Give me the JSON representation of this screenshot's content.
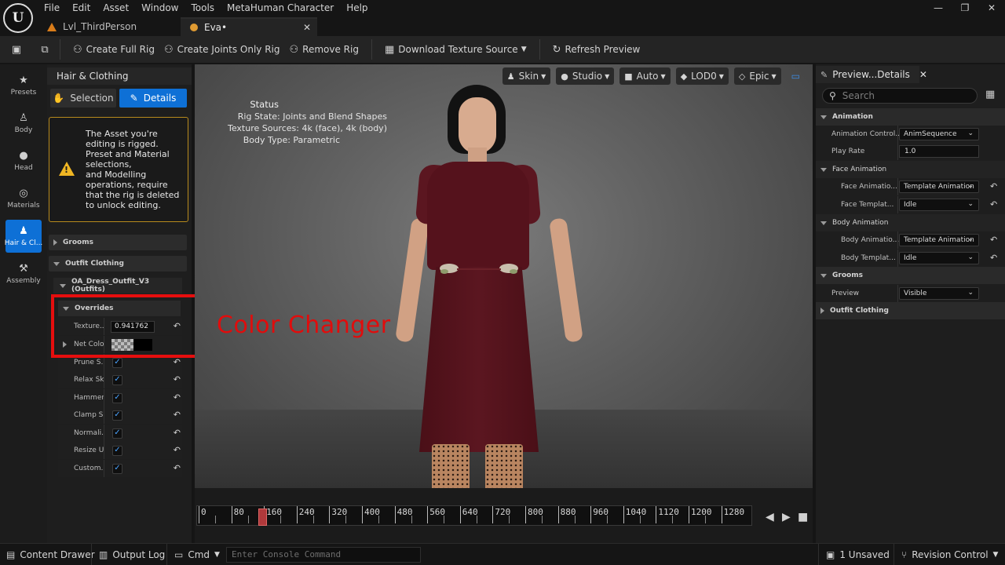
{
  "app": {
    "logo_text": "U"
  },
  "menu": [
    "File",
    "Edit",
    "Asset",
    "Window",
    "Tools",
    "MetaHuman Character",
    "Help"
  ],
  "window_controls": {
    "minimize": "—",
    "restore": "❐",
    "close": "✕"
  },
  "tabs": [
    {
      "label": "Lvl_ThirdPerson"
    },
    {
      "label": "Eva•",
      "close": "✕"
    }
  ],
  "toolbar": {
    "create_full_rig": "Create Full Rig",
    "create_joints_only_rig": "Create Joints Only Rig",
    "remove_rig": "Remove Rig",
    "download_texture_source": "Download Texture Source",
    "refresh_preview": "Refresh Preview"
  },
  "modes": [
    {
      "label": "Presets",
      "icon": "star-icon"
    },
    {
      "label": "Body",
      "icon": "body-icon"
    },
    {
      "label": "Head",
      "icon": "head-icon"
    },
    {
      "label": "Materials",
      "icon": "materials-icon"
    },
    {
      "label": "Hair & Cl...",
      "icon": "hair-clothing-icon",
      "active": true
    },
    {
      "label": "Assembly",
      "icon": "hammer-icon"
    }
  ],
  "left_panel": {
    "title": "Hair & Clothing",
    "selection_label": "Selection",
    "details_label": "Details",
    "warning_text": "The Asset you're\nediting is rigged.\nPreset and Material\nselections,\nand Modelling\noperations, require\nthat the rig is deleted\nto unlock editing.",
    "grooms": "Grooms",
    "outfit_clothing": "Outfit Clothing",
    "outfit_asset": "OA_Dress_Outfit_V3 (Outfits)",
    "overrides": "Overrides",
    "texture_label": "Texture...",
    "texture_value": "0.941762",
    "net_color_label": "Net Color",
    "checkbox_rows": [
      "Prune S...",
      "Relax Sk...",
      "Hammer...",
      "Clamp S...",
      "Normali...",
      "Resize U...",
      "Custom..."
    ]
  },
  "viewport": {
    "pills": [
      {
        "label": "Skin",
        "icon": "skin-icon"
      },
      {
        "label": "Studio",
        "icon": "lightbulb-icon"
      },
      {
        "label": "Auto",
        "icon": "camera-icon"
      },
      {
        "label": "LOD0",
        "icon": "cube-icon"
      },
      {
        "label": "Epic",
        "icon": "diamond-icon"
      }
    ],
    "status_title": "Status",
    "rig_state": "Rig State: Joints and Blend Shapes",
    "texture_sources": "Texture Sources: 4k (face), 4k (body)",
    "body_type": "Body Type: Parametric",
    "annotation": "Color Changer"
  },
  "timeline": {
    "ticks": [
      "0",
      "80",
      "160",
      "240",
      "320",
      "400",
      "480",
      "560",
      "640",
      "720",
      "800",
      "880",
      "960",
      "1040",
      "1120",
      "1200",
      "1280"
    ]
  },
  "right_panel": {
    "tab_label": "Preview...Details",
    "search_placeholder": "Search",
    "sections": {
      "animation": "Animation",
      "face_animation": "Face Animation",
      "body_animation": "Body Animation",
      "grooms": "Grooms",
      "outfit_clothing": "Outfit Clothing"
    },
    "animation_control_label": "Animation Control...",
    "animation_control_value": "AnimSequence",
    "play_rate_label": "Play Rate",
    "play_rate_value": "1.0",
    "face_animation_label": "Face Animatio...",
    "face_animation_value": "Template Animation",
    "face_template_label": "Face Templat...",
    "face_template_value": "Idle",
    "body_animation_label": "Body Animatio...",
    "body_animation_value": "Template Animation",
    "body_template_label": "Body Templat...",
    "body_template_value": "Idle",
    "grooms_preview_label": "Preview",
    "grooms_preview_value": "Visible"
  },
  "statusbar": {
    "content_drawer": "Content Drawer",
    "output_log": "Output Log",
    "cmd": "Cmd",
    "console_placeholder": "Enter Console Command",
    "unsaved": "1 Unsaved",
    "revision_control": "Revision Control"
  }
}
